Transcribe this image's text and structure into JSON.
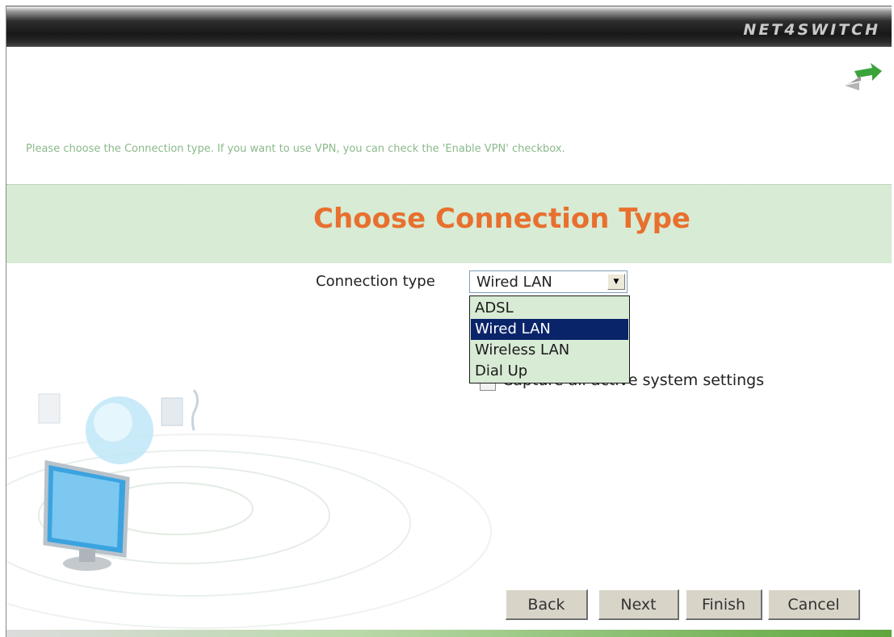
{
  "header": {
    "brand": "NET4SWITCH"
  },
  "instructions": "Please choose the Connection type. If you want to use VPN, you can check the 'Enable VPN' checkbox.",
  "banner": {
    "title": "Choose Connection Type"
  },
  "connection": {
    "label": "Connection type",
    "selected": "Wired LAN",
    "options": [
      "ADSL",
      "Wired LAN",
      "Wireless LAN",
      "Dial Up"
    ],
    "highlighted_index": 1
  },
  "capture": {
    "label": "Capture all active system settings",
    "checked": false
  },
  "buttons": {
    "back": "Back",
    "next": "Next",
    "finish": "Finish",
    "cancel": "Cancel"
  },
  "colors": {
    "accent": "#e8702e",
    "banner_bg": "#d8ebd5",
    "instructions": "#8bb98b",
    "selection": "#0a246a"
  }
}
